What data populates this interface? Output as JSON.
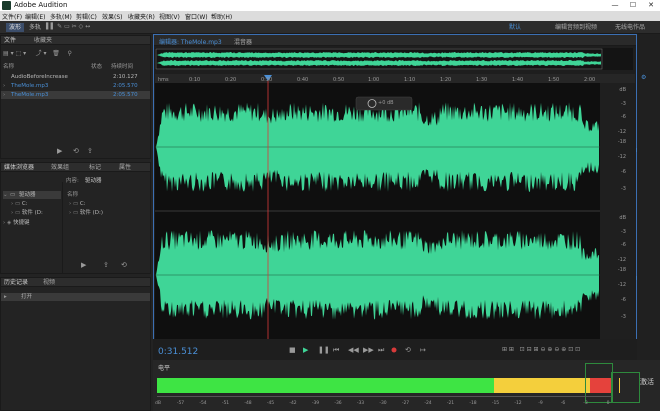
{
  "app": {
    "title": "Adobe Audition"
  },
  "window_controls": {
    "minimize": "—",
    "maximize": "☐",
    "close": "✕"
  },
  "menu": [
    "文件(F)",
    "编辑(E)",
    "多轨(M)",
    "剪辑(C)",
    "效果(S)",
    "收藏夹(R)",
    "视图(V)",
    "窗口(W)",
    "帮助(H)"
  ],
  "toolbar": {
    "waveform_label": "波形",
    "multitrack_label": "多轨",
    "workspace_default": "默认",
    "workspace_edit_audio_video": "编辑音频到视频",
    "workspace_radio": "无线电作品"
  },
  "files_panel": {
    "tabs": [
      "文件",
      "收藏夹"
    ],
    "columns": {
      "name": "名称",
      "status": "状态",
      "duration": "持续时间"
    },
    "files": [
      {
        "name": "AudioBeforeIncrease",
        "duration": "2:10.127",
        "highlight": false
      },
      {
        "name": "TheMole.mp3",
        "duration": "2:05.570",
        "highlight": true
      },
      {
        "name": "TheMole.mp3",
        "duration": "2:05.570",
        "highlight": true
      }
    ]
  },
  "media_panel": {
    "tabs": [
      "媒体浏览器",
      "效果组",
      "标记",
      "属性"
    ],
    "content_label": "内容:",
    "content_value": "驱动器",
    "tree": [
      "驱动器",
      "C:",
      "软件 (D:",
      "快捷键"
    ],
    "name_header": "名称",
    "list": [
      "C:",
      "软件 (D:)"
    ]
  },
  "history_panel": {
    "tabs": [
      "历史记录",
      "视频"
    ],
    "items": [
      "打开"
    ]
  },
  "editor": {
    "tabs": [
      "编辑器: TheMole.mp3",
      "混音器"
    ],
    "time_display": "0:31.512",
    "hud_value": "+0 dB",
    "ruler_labels": [
      "hms",
      "0:10",
      "0:20",
      "0:30",
      "0:40",
      "0:50",
      "1:00",
      "1:10",
      "1:20",
      "1:30",
      "1:40",
      "1:50",
      "2:00"
    ],
    "db_labels_top": [
      "dB",
      "-3",
      "-6",
      "-12",
      "-18",
      "-12",
      "-6",
      "-3"
    ],
    "db_labels_bottom": [
      "dB",
      "-3",
      "-6",
      "-12",
      "-18",
      "-12",
      "-6",
      "-3"
    ],
    "channel_top": "L",
    "channel_bottom": "R",
    "waveform_color": "#3fd597",
    "playhead_color": "#d83a3a"
  },
  "level_panel": {
    "title": "电平",
    "scale_labels": [
      "dB",
      "-57",
      "-54",
      "-51",
      "-48",
      "-45",
      "-42",
      "-39",
      "-36",
      "-33",
      "-30",
      "-27",
      "-24",
      "-21",
      "-18",
      "-15",
      "-12",
      "-9",
      "-6",
      "-3",
      "0"
    ],
    "activate_text": "激活"
  }
}
